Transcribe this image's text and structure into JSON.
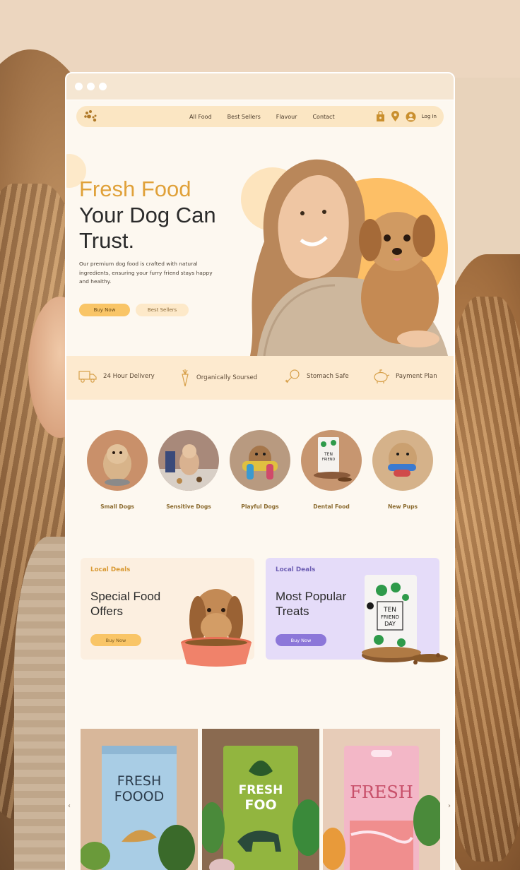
{
  "nav": {
    "links": [
      "All Food",
      "Best Sellers",
      "Flavour",
      "Contact"
    ],
    "login": "Log In"
  },
  "hero": {
    "title_accent": "Fresh Food",
    "title_line2": "Your Dog Can",
    "title_line3": "Trust.",
    "description": "Our premium dog food is crafted with natural ingredients, ensuring your furry friend stays happy and healthy.",
    "buy_label": "Buy Now",
    "best_label": "Best Sellers"
  },
  "features": [
    {
      "label": "24 Hour Delivery",
      "icon": "truck-icon"
    },
    {
      "label": "Organically Soursed",
      "icon": "carrot-icon"
    },
    {
      "label": "Stomach Safe",
      "icon": "bone-icon"
    },
    {
      "label": "Payment Plan",
      "icon": "piggy-bank-icon"
    }
  ],
  "categories": [
    "Small Dogs",
    "Sensitive Dogs",
    "Playful Dogs",
    "Dental Food",
    "New Pups"
  ],
  "packaging": {
    "bag_line1": "TEN",
    "bag_line2": "FRIEND",
    "bag_line3": "DAY"
  },
  "deals": [
    {
      "tag": "Local Deals",
      "title_l1": "Special Food",
      "title_l2": "Offers",
      "button": "Buy Now"
    },
    {
      "tag": "Local Deals",
      "title_l1": "Most Popular",
      "title_l2": "Treats",
      "button": "Buy Now"
    }
  ],
  "products": [
    {
      "line1": "FRESH",
      "line2": "FOOOD"
    },
    {
      "line1": "FRESH",
      "line2": "FOO"
    },
    {
      "line1": "FRESH",
      "line2": ""
    }
  ],
  "carousel": {
    "prev": "‹",
    "next": "›"
  },
  "colors": {
    "accent": "#e0a139",
    "button": "#f9c567",
    "purple": "#8c77d9",
    "cream": "#fdf8f0"
  }
}
